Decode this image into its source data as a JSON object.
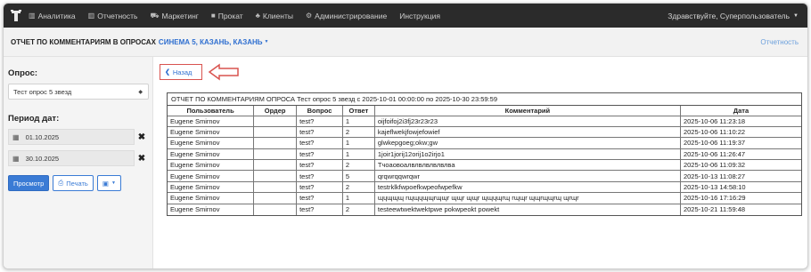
{
  "navbar": {
    "items": [
      {
        "label": "Аналитика",
        "icon": "bar-chart-icon"
      },
      {
        "label": "Отчетность",
        "icon": "bar-chart-icon"
      },
      {
        "label": "Маркетинг",
        "icon": "cart-icon"
      },
      {
        "label": "Прокат",
        "icon": "film-icon"
      },
      {
        "label": "Клиенты",
        "icon": "users-icon"
      },
      {
        "label": "Администрирование",
        "icon": "gears-icon"
      },
      {
        "label": "Инструкция",
        "icon": ""
      }
    ],
    "user_label": "Здравствуйте, Суперпользователь"
  },
  "subheader": {
    "title": "ОТЧЕТ ПО КОММЕНТАРИЯМ В ОПРОСАХ",
    "cinema": "СИНЕМА 5, КАЗАНЬ, КАЗАНЬ",
    "right_link": "Отчетность"
  },
  "sidebar": {
    "survey_label": "Опрос:",
    "survey_value": "Тест опрос 5 звезд",
    "period_label": "Период дат:",
    "date_from": "01.10.2025",
    "date_to": "30.10.2025",
    "view_button": "Просмотр",
    "print_button": "Печать"
  },
  "main": {
    "back_button": "Назад",
    "report_caption": "ОТЧЕТ ПО КОММЕНТАРИЯМ ОПРОСА Тест опрос 5 звезд с 2025-10-01 00:00:00 по 2025-10-30 23:59:59",
    "columns": [
      "Пользователь",
      "Ордер",
      "Вопрос",
      "Ответ",
      "Комментарий",
      "Дата"
    ],
    "rows": [
      [
        "Eugene Smirnov",
        "",
        "test?",
        "1",
        "oijfoifoj2i3fj23r23r23",
        "2025-10-06 11:23:18"
      ],
      [
        "Eugene Smirnov",
        "",
        "test?",
        "2",
        "kajeflwekjfowjefowief",
        "2025-10-06 11:10:22"
      ],
      [
        "Eugene Smirnov",
        "",
        "test?",
        "1",
        "glwkepgoeg;okw;gw",
        "2025-10-06 11:19:37"
      ],
      [
        "Eugene Smirnov",
        "",
        "test?",
        "1",
        "1joir1jorij12orij1o2irjo1",
        "2025-10-06 11:26:47"
      ],
      [
        "Eugene Smirnov",
        "",
        "test?",
        "2",
        "Тчоаовоалвлвлвлвлвлва",
        "2025-10-06 11:09:32"
      ],
      [
        "Eugene Smirnov",
        "",
        "test?",
        "5",
        "qrqwrqqwrqwr",
        "2025-10-13 11:08:27"
      ],
      [
        "Eugene Smirnov",
        "",
        "test?",
        "2",
        "testrklkfwpoefkwpeofwpefkw",
        "2025-10-13 14:58:10"
      ],
      [
        "Eugene Smirnov",
        "",
        "test?",
        "1",
        "ɰɥɰɰɰ rɰɰɥɰɰrɰɰr ɰɰr ɰɰr ɰɰɥɰrɰ rɰɰr ɰɰrɰɰrɰ ɰrɰr",
        "2025-10-16 17:16:29"
      ],
      [
        "Eugene Smirnov",
        "",
        "test?",
        "2",
        "testeewtwektwektpwe pokwpeokt powekt",
        "2025-10-21 11:59:48"
      ]
    ]
  },
  "colors": {
    "navbar_bg": "#2b2b2b",
    "accent": "#3a7bd5",
    "annotation": "#d9534f"
  }
}
